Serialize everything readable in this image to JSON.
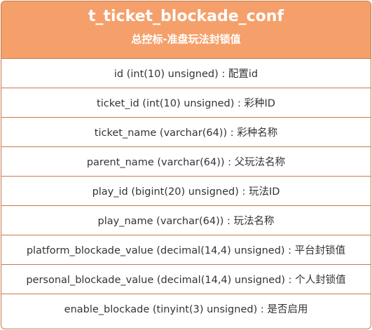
{
  "table": {
    "name": "t_ticket_blockade_conf",
    "comment": "总控标-准盘玩法封锁值",
    "fields": [
      "id (int(10) unsigned) : 配置id",
      "ticket_id (int(10) unsigned) : 彩种ID",
      "ticket_name (varchar(64)) : 彩种名称",
      "parent_name (varchar(64)) : 父玩法名称",
      "play_id (bigint(20) unsigned) : 玩法ID",
      "play_name (varchar(64)) : 玩法名称",
      "platform_blockade_value (decimal(14,4) unsigned) : 平台封锁值",
      "personal_blockade_value (decimal(14,4) unsigned) : 个人封锁值",
      "enable_blockade (tinyint(3) unsigned) : 是否启用"
    ],
    "colors": {
      "header_fill": "#f5a06b",
      "border": "#c9794d",
      "header_text": "#ffffff",
      "field_text": "#333333"
    }
  }
}
